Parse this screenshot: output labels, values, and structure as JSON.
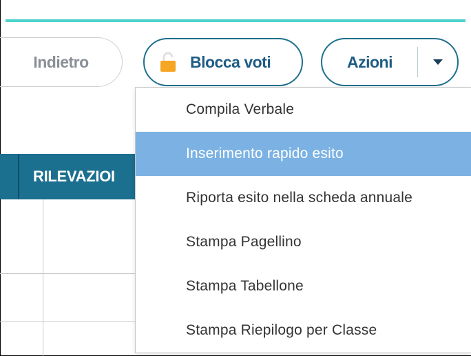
{
  "toolbar": {
    "back_label": "Indietro",
    "lock_label": "Blocca voti",
    "actions_label": "Azioni"
  },
  "table": {
    "header_label": "RILEVAZIOI"
  },
  "menu": {
    "items": [
      {
        "label": "Compila Verbale"
      },
      {
        "label": "Inserimento rapido esito"
      },
      {
        "label": "Riporta esito nella scheda annuale"
      },
      {
        "label": "Stampa Pagellino"
      },
      {
        "label": "Stampa Tabellone"
      },
      {
        "label": "Stampa Riepilogo per Classe"
      }
    ],
    "highlighted_index": 1
  },
  "colors": {
    "accent_teal": "#4fd1cc",
    "button_border": "#1d6f8c",
    "table_header": "#1b6f8f",
    "menu_highlight": "#7bb2e3",
    "lock_icon": "#f5a623"
  },
  "icons": {
    "lock": "lock-icon",
    "caret": "caret-down-icon"
  }
}
